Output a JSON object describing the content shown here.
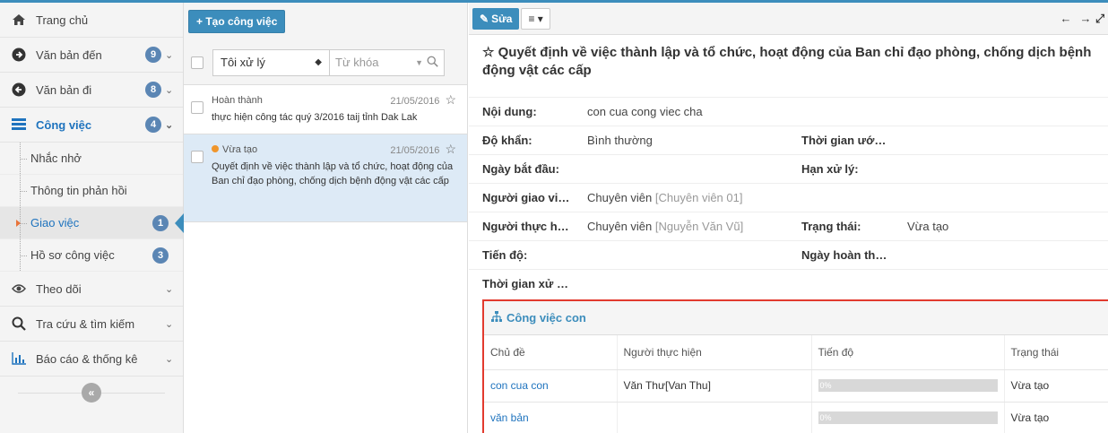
{
  "sidebar": {
    "items": [
      {
        "label": "Trang chủ",
        "icon": "home-icon"
      },
      {
        "label": "Văn bản đến",
        "badge": "9",
        "icon": "arrow-right-circle-icon"
      },
      {
        "label": "Văn bản đi",
        "badge": "8",
        "icon": "arrow-left-circle-icon"
      },
      {
        "label": "Công việc",
        "badge": "4",
        "icon": "tasks-icon"
      }
    ],
    "sub_items": [
      {
        "label": "Nhắc nhở"
      },
      {
        "label": "Thông tin phản hồi"
      },
      {
        "label": "Giao việc",
        "badge": "1"
      },
      {
        "label": "Hồ sơ công việc",
        "badge": "3"
      }
    ],
    "more_items": [
      {
        "label": "Theo dõi",
        "icon": "eye-icon"
      },
      {
        "label": "Tra cứu & tìm kiếm",
        "icon": "search-icon"
      },
      {
        "label": "Báo cáo & thống kê",
        "icon": "bar-chart-icon"
      }
    ],
    "collapse_label": "«"
  },
  "middle": {
    "create_label": "+ Tạo công việc",
    "filter_value": "Tôi xử lý",
    "search_placeholder": "Từ khóa",
    "tasks": [
      {
        "status": "Hoàn thành",
        "date": "21/05/2016",
        "title": "thực hiện công tác quý 3/2016 taij tỉnh Dak Lak"
      },
      {
        "status": "Vừa tạo",
        "date": "21/05/2016",
        "title": "Quyết định về việc thành lập và tổ chức, hoạt động của Ban chỉ đạo phòng, chống dịch bệnh động vật các cấp"
      }
    ]
  },
  "detail": {
    "edit_label": "Sửa",
    "menu_label": "≡ ▾",
    "title": "Quyết định về việc thành lập và tổ chức, hoạt động của Ban chỉ đạo phòng, chống dịch bệnh động vật các cấp",
    "fields": {
      "noi_dung_label": "Nội dung:",
      "noi_dung": "con cua cong viec cha",
      "do_khan_label": "Độ khẩn:",
      "do_khan": "Bình thường",
      "thoi_gian_uoc_label": "Thời gian ướ…",
      "ngay_bat_dau_label": "Ngày bắt đầu:",
      "han_xu_ly_label": "Hạn xử lý:",
      "nguoi_giao_label": "Người giao vi…",
      "nguoi_giao": "Chuyên viên",
      "nguoi_giao_extra": "[Chuyên viên 01]",
      "nguoi_thuc_hien_label": "Người thực h…",
      "nguoi_thuc_hien": "Chuyên viên",
      "nguoi_thuc_hien_extra": "[Nguyễn Văn Vũ]",
      "trang_thai_label": "Trạng thái:",
      "trang_thai": "Vừa tạo",
      "tien_do_label": "Tiến độ:",
      "ngay_hoan_thanh_label": "Ngày hoàn th…",
      "thoi_gian_xu_label": "Thời gian xử …"
    },
    "subtasks": {
      "title": "Công việc con",
      "columns": [
        "Chủ đề",
        "Người thực hiện",
        "Tiến độ",
        "Trạng thái"
      ],
      "rows": [
        {
          "topic": "con cua con",
          "assignee": "Văn Thư[Van Thu]",
          "progress": "0%",
          "status": "Vừa tạo"
        },
        {
          "topic": "văn bản",
          "assignee": "",
          "progress": "0%",
          "status": "Vừa tạo"
        }
      ]
    }
  },
  "colors": {
    "accent": "#3c8dbc",
    "highlight_border": "#e23a2e",
    "status_dot": "#f0962c"
  }
}
